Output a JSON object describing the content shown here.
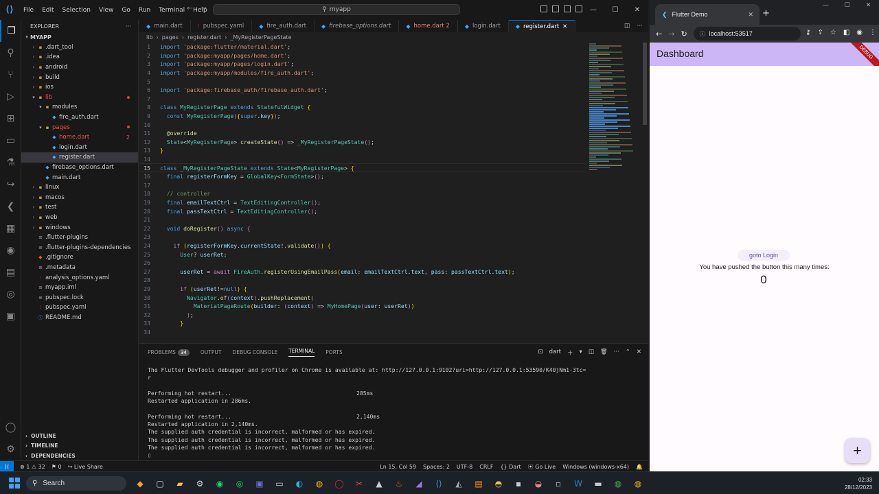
{
  "vscode": {
    "menu": [
      "File",
      "Edit",
      "Selection",
      "View",
      "Go",
      "Run",
      "Terminal",
      "Help"
    ],
    "search": "myapp",
    "explorer_title": "EXPLORER",
    "project": "MYAPP",
    "tree": [
      {
        "label": ".dart_tool",
        "kind": "folder",
        "depth": 1
      },
      {
        "label": ".idea",
        "kind": "folder",
        "depth": 1
      },
      {
        "label": "android",
        "kind": "folder",
        "depth": 1
      },
      {
        "label": "build",
        "kind": "folder",
        "depth": 1
      },
      {
        "label": "ios",
        "kind": "folder",
        "depth": 1
      },
      {
        "label": "lib",
        "kind": "folder-open",
        "depth": 1,
        "error": true
      },
      {
        "label": "modules",
        "kind": "folder-open",
        "depth": 2
      },
      {
        "label": "fire_auth.dart",
        "kind": "dart",
        "depth": 3
      },
      {
        "label": "pages",
        "kind": "folder-open",
        "depth": 2,
        "error": true
      },
      {
        "label": "home.dart",
        "kind": "dart",
        "depth": 3,
        "error": true,
        "badge": "2"
      },
      {
        "label": "login.dart",
        "kind": "dart",
        "depth": 3
      },
      {
        "label": "register.dart",
        "kind": "dart",
        "depth": 3,
        "selected": true
      },
      {
        "label": "firebase_options.dart",
        "kind": "dart",
        "depth": 2
      },
      {
        "label": "main.dart",
        "kind": "dart",
        "depth": 2
      },
      {
        "label": "linux",
        "kind": "folder",
        "depth": 1
      },
      {
        "label": "macos",
        "kind": "folder",
        "depth": 1
      },
      {
        "label": "test",
        "kind": "folder",
        "depth": 1
      },
      {
        "label": "web",
        "kind": "folder",
        "depth": 1
      },
      {
        "label": "windows",
        "kind": "folder",
        "depth": 1
      },
      {
        "label": ".flutter-plugins",
        "kind": "file",
        "depth": 1
      },
      {
        "label": ".flutter-plugins-dependencies",
        "kind": "file",
        "depth": 1
      },
      {
        "label": ".gitignore",
        "kind": "git",
        "depth": 1
      },
      {
        "label": ".metadata",
        "kind": "file",
        "depth": 1
      },
      {
        "label": "analysis_options.yaml",
        "kind": "yaml",
        "depth": 1
      },
      {
        "label": "myapp.iml",
        "kind": "file",
        "depth": 1
      },
      {
        "label": "pubspec.lock",
        "kind": "file",
        "depth": 1
      },
      {
        "label": "pubspec.yaml",
        "kind": "yaml",
        "depth": 1
      },
      {
        "label": "README.md",
        "kind": "info",
        "depth": 1
      }
    ],
    "sections": [
      "OUTLINE",
      "TIMELINE",
      "DEPENDENCIES"
    ],
    "tabs": [
      {
        "label": "main.dart",
        "state": "normal"
      },
      {
        "label": "pubspec.yaml",
        "state": "normal"
      },
      {
        "label": "fire_auth.dart",
        "state": "normal"
      },
      {
        "label": "firebase_options.dart",
        "state": "italic"
      },
      {
        "label": "home.dart 2",
        "state": "modified"
      },
      {
        "label": "login.dart",
        "state": "normal"
      },
      {
        "label": "register.dart",
        "state": "active"
      }
    ],
    "breadcrumb": [
      "lib",
      "pages",
      "register.dart",
      "_MyRegisterPageState"
    ],
    "code": [
      {
        "n": "1",
        "parts": [
          [
            "k",
            "import "
          ],
          [
            "s",
            "'package:flutter/material.dart'"
          ],
          [
            "d",
            ";"
          ]
        ]
      },
      {
        "n": "2",
        "parts": [
          [
            "k",
            "import "
          ],
          [
            "s",
            "'package:myapp/pages/home.dart'"
          ],
          [
            "d",
            ";"
          ]
        ]
      },
      {
        "n": "3",
        "parts": [
          [
            "k",
            "import "
          ],
          [
            "s",
            "'package:myapp/pages/login.dart'"
          ],
          [
            "d",
            ";"
          ]
        ]
      },
      {
        "n": "4",
        "parts": [
          [
            "k",
            "import "
          ],
          [
            "s",
            "'package:myapp/modules/fire_auth.dart'"
          ],
          [
            "d",
            ";"
          ]
        ]
      },
      {
        "n": "5",
        "parts": []
      },
      {
        "n": "6",
        "parts": [
          [
            "k",
            "import "
          ],
          [
            "s",
            "'package:firebase_auth/firebase_auth.dart'"
          ],
          [
            "d",
            ";"
          ]
        ]
      },
      {
        "n": "7",
        "parts": []
      },
      {
        "n": "8",
        "parts": [
          [
            "k",
            "class "
          ],
          [
            "t",
            "MyRegisterPage "
          ],
          [
            "k",
            "extends "
          ],
          [
            "t",
            "StatefulWidget "
          ],
          [
            "y",
            "{"
          ]
        ]
      },
      {
        "n": "9",
        "parts": [
          [
            "d",
            "  "
          ],
          [
            "k",
            "const "
          ],
          [
            "t",
            "MyRegisterPage"
          ],
          [
            "p",
            "("
          ],
          [
            "y",
            "{"
          ],
          [
            "k",
            "super"
          ],
          [
            "d",
            "."
          ],
          [
            "v",
            "key"
          ],
          [
            "y",
            "}"
          ],
          [
            "p",
            ")"
          ],
          [
            "d",
            ";"
          ]
        ]
      },
      {
        "n": "10",
        "parts": []
      },
      {
        "n": "11",
        "parts": [
          [
            "d",
            "  "
          ],
          [
            "f",
            "@override"
          ]
        ]
      },
      {
        "n": "12",
        "parts": [
          [
            "d",
            "  "
          ],
          [
            "t",
            "State"
          ],
          [
            "d",
            "<"
          ],
          [
            "t",
            "MyRegisterPage"
          ],
          [
            "d",
            "> "
          ],
          [
            "f",
            "createState"
          ],
          [
            "p",
            "()"
          ],
          [
            "d",
            " => "
          ],
          [
            "t",
            "_MyRegisterPageState"
          ],
          [
            "p",
            "()"
          ],
          [
            "d",
            ";"
          ]
        ]
      },
      {
        "n": "13",
        "parts": [
          [
            "y",
            "}"
          ]
        ]
      },
      {
        "n": "14",
        "parts": []
      },
      {
        "n": "15",
        "parts": [
          [
            "k",
            "class "
          ],
          [
            "t",
            "_MyRegisterPageState "
          ],
          [
            "k",
            "extends "
          ],
          [
            "t",
            "State"
          ],
          [
            "d",
            "<"
          ],
          [
            "t",
            "MyRegisterPage"
          ],
          [
            "d",
            "> "
          ],
          [
            "y",
            "{"
          ]
        ],
        "current": true
      },
      {
        "n": "16",
        "parts": [
          [
            "d",
            "  "
          ],
          [
            "k",
            "final "
          ],
          [
            "v",
            "registerFormKey "
          ],
          [
            "d",
            "= "
          ],
          [
            "t",
            "GlobalKey"
          ],
          [
            "d",
            "<"
          ],
          [
            "t",
            "FormState"
          ],
          [
            "d",
            ">"
          ],
          [
            "p",
            "()"
          ],
          [
            "d",
            ";"
          ]
        ]
      },
      {
        "n": "17",
        "parts": []
      },
      {
        "n": "18",
        "parts": [
          [
            "d",
            "  "
          ],
          [
            "c",
            "// controller"
          ]
        ]
      },
      {
        "n": "19",
        "parts": [
          [
            "d",
            "  "
          ],
          [
            "k",
            "final "
          ],
          [
            "v",
            "emailTextCtrl "
          ],
          [
            "d",
            "= "
          ],
          [
            "t",
            "TextEditingController"
          ],
          [
            "p",
            "()"
          ],
          [
            "d",
            ";"
          ]
        ]
      },
      {
        "n": "20",
        "parts": [
          [
            "d",
            "  "
          ],
          [
            "k",
            "final "
          ],
          [
            "v",
            "passTextCtrl "
          ],
          [
            "d",
            "= "
          ],
          [
            "t",
            "TextEditingController"
          ],
          [
            "p",
            "()"
          ],
          [
            "d",
            ";"
          ]
        ]
      },
      {
        "n": "21",
        "parts": []
      },
      {
        "n": "22",
        "parts": [
          [
            "d",
            "  "
          ],
          [
            "k",
            "void "
          ],
          [
            "f",
            "doRegister"
          ],
          [
            "p",
            "() "
          ],
          [
            "k",
            "async "
          ],
          [
            "p",
            "{"
          ]
        ]
      },
      {
        "n": "23",
        "parts": []
      },
      {
        "n": "24",
        "parts": [
          [
            "d",
            "    "
          ],
          [
            "p",
            "if "
          ],
          [
            "y",
            "("
          ],
          [
            "v",
            "registerFormKey"
          ],
          [
            "d",
            "."
          ],
          [
            "v",
            "currentState"
          ],
          [
            "d",
            "!."
          ],
          [
            "f",
            "validate"
          ],
          [
            "p",
            "()"
          ],
          [
            "y",
            ") "
          ],
          [
            "y",
            "{"
          ]
        ]
      },
      {
        "n": "25",
        "parts": [
          [
            "d",
            "      "
          ],
          [
            "t",
            "User"
          ],
          [
            "d",
            "? "
          ],
          [
            "v",
            "userRet"
          ],
          [
            "d",
            ";"
          ]
        ]
      },
      {
        "n": "26",
        "parts": []
      },
      {
        "n": "27",
        "parts": [
          [
            "d",
            "      "
          ],
          [
            "v",
            "userRet "
          ],
          [
            "d",
            "= "
          ],
          [
            "p",
            "await "
          ],
          [
            "t",
            "FireAuth"
          ],
          [
            "d",
            "."
          ],
          [
            "f",
            "registerUsingEmailPass"
          ],
          [
            "y",
            "("
          ],
          [
            "v",
            "email"
          ],
          [
            "d",
            ": "
          ],
          [
            "v",
            "emailTextCtrl"
          ],
          [
            "d",
            "."
          ],
          [
            "v",
            "text"
          ],
          [
            "d",
            ", "
          ],
          [
            "v",
            "pass"
          ],
          [
            "d",
            ": "
          ],
          [
            "v",
            "passTextCtrl"
          ],
          [
            "d",
            "."
          ],
          [
            "v",
            "text"
          ],
          [
            "y",
            ")"
          ],
          [
            "d",
            ";"
          ]
        ]
      },
      {
        "n": "28",
        "parts": []
      },
      {
        "n": "29",
        "parts": [
          [
            "d",
            "      "
          ],
          [
            "p",
            "if "
          ],
          [
            "y",
            "("
          ],
          [
            "v",
            "userRet"
          ],
          [
            "d",
            "!="
          ],
          [
            "k",
            "null"
          ],
          [
            "y",
            ") "
          ],
          [
            "y",
            "{"
          ]
        ]
      },
      {
        "n": "30",
        "parts": [
          [
            "d",
            "        "
          ],
          [
            "t",
            "Navigator"
          ],
          [
            "d",
            "."
          ],
          [
            "f",
            "of"
          ],
          [
            "p",
            "("
          ],
          [
            "v",
            "context"
          ],
          [
            "p",
            ")"
          ],
          [
            "d",
            "."
          ],
          [
            "f",
            "pushReplacement"
          ],
          [
            "p",
            "("
          ]
        ]
      },
      {
        "n": "31",
        "parts": [
          [
            "d",
            "          "
          ],
          [
            "t",
            "MaterialPageRoute"
          ],
          [
            "y",
            "("
          ],
          [
            "v",
            "builder"
          ],
          [
            "d",
            ": "
          ],
          [
            "p",
            "("
          ],
          [
            "v",
            "context"
          ],
          [
            "p",
            ")"
          ],
          [
            "d",
            " => "
          ],
          [
            "t",
            "MyHomePage"
          ],
          [
            "p",
            "("
          ],
          [
            "v",
            "user"
          ],
          [
            "d",
            ": "
          ],
          [
            "v",
            "userRet"
          ],
          [
            "p",
            ")"
          ],
          [
            "y",
            ")"
          ]
        ]
      },
      {
        "n": "32",
        "parts": [
          [
            "d",
            "        "
          ],
          [
            "p",
            ")"
          ],
          [
            "d",
            ";"
          ]
        ]
      },
      {
        "n": "33",
        "parts": [
          [
            "d",
            "      "
          ],
          [
            "y",
            "}"
          ]
        ]
      },
      {
        "n": "34",
        "parts": []
      }
    ],
    "panel_tabs": [
      {
        "label": "PROBLEMS",
        "count": "34"
      },
      {
        "label": "OUTPUT"
      },
      {
        "label": "DEBUG CONSOLE"
      },
      {
        "label": "TERMINAL",
        "active": true
      },
      {
        "label": "PORTS"
      }
    ],
    "terminal_kind": "dart",
    "terminal": [
      {
        "l": "The Flutter DevTools debugger and profiler on Chrome is available at: http://127.0.0.1:9102?uri=http://127.0.0.1:53590/K40jNm1-3tc=",
        "r": ""
      },
      {
        "l": "r",
        "r": ""
      },
      {
        "l": "",
        "r": ""
      },
      {
        "l": "Performing hot restart...",
        "r": "285ms"
      },
      {
        "l": "Restarted application in 286ms.",
        "r": ""
      },
      {
        "l": "",
        "r": ""
      },
      {
        "l": "Performing hot restart...",
        "r": "2,140ms"
      },
      {
        "l": "Restarted application in 2,140ms.",
        "r": ""
      },
      {
        "l": "The supplied auth credential is incorrect, malformed or has expired.",
        "r": ""
      },
      {
        "l": "The supplied auth credential is incorrect, malformed or has expired.",
        "r": ""
      },
      {
        "l": "The supplied auth credential is incorrect, malformed or has expired.",
        "r": ""
      }
    ],
    "status": {
      "errors": "1",
      "warnings": "32",
      "ports": "0",
      "liveshare": "Live Share",
      "position": "Ln 15, Col 59",
      "spaces": "Spaces: 2",
      "encoding": "UTF-8",
      "eol": "CRLF",
      "language": "Dart",
      "golive": "Go Live",
      "device": "Windows (windows-x64)"
    }
  },
  "browser": {
    "tab_title": "Flutter Demo",
    "url": "localhost:53517",
    "app_title": "Dashboard",
    "debug_banner": "DEBUG",
    "goto_login": "goto Login",
    "pushed_text": "You have pushed the button this many times:",
    "counter": "0",
    "fab": "+"
  },
  "taskbar": {
    "search": "Search",
    "time": "02:33",
    "date": "28/12/2023"
  }
}
